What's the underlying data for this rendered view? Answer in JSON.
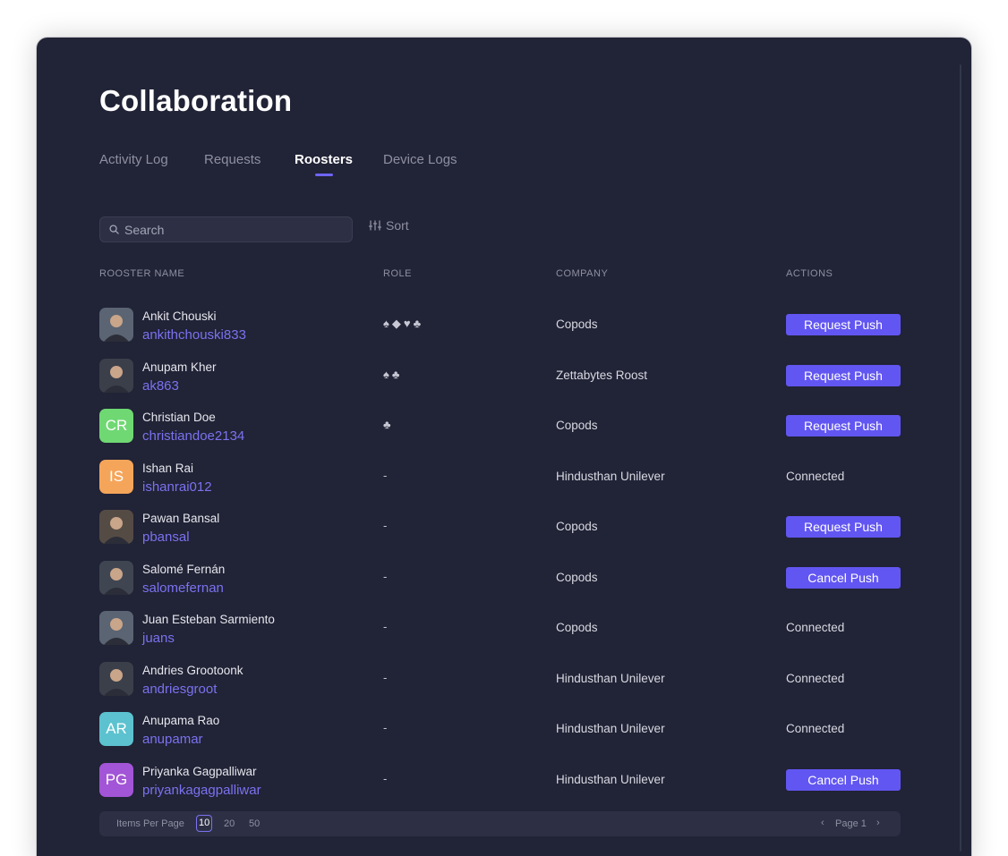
{
  "page": {
    "title": "Collaboration"
  },
  "tabs": [
    {
      "label": "Activity Log",
      "active": false
    },
    {
      "label": "Requests",
      "active": false
    },
    {
      "label": "Roosters",
      "active": true
    },
    {
      "label": "Device Logs",
      "active": false
    }
  ],
  "toolbar": {
    "search_placeholder": "Search",
    "sort_label": "Sort"
  },
  "table": {
    "headers": {
      "name": "ROOSTER NAME",
      "role": "ROLE",
      "company": "COMPANY",
      "actions": "ACTIONS"
    },
    "rows": [
      {
        "name": "Ankit Chouski",
        "username": "ankithchouski833",
        "avatar_type": "photo",
        "role": "♠◆♥♣",
        "company": "Copods",
        "action": "Request Push",
        "action_type": "button"
      },
      {
        "name": "Anupam Kher",
        "username": "ak863",
        "avatar_type": "photo",
        "role": "♠♣",
        "company": "Zettabytes Roost",
        "action": "Request Push",
        "action_type": "button"
      },
      {
        "name": "Christian Doe",
        "username": "christiandoe2134",
        "avatar_type": "initials",
        "initials": "CR",
        "avatar_color": "#6fd873",
        "role": "♣",
        "company": "Copods",
        "action": "Request Push",
        "action_type": "button"
      },
      {
        "name": "Ishan Rai",
        "username": "ishanrai012",
        "avatar_type": "initials",
        "initials": "IS",
        "avatar_color": "#f5a55a",
        "role": "-",
        "company": "Hindusthan Unilever",
        "action": "Connected",
        "action_type": "text"
      },
      {
        "name": "Pawan Bansal",
        "username": "pbansal",
        "avatar_type": "photo",
        "role": "-",
        "company": "Copods",
        "action": "Request Push",
        "action_type": "button"
      },
      {
        "name": "Salomé Fernán",
        "username": "salomefernan",
        "avatar_type": "photo",
        "role": "-",
        "company": "Copods",
        "action": "Cancel Push",
        "action_type": "button"
      },
      {
        "name": "Juan Esteban Sarmiento",
        "username": "juans",
        "avatar_type": "photo",
        "role": "-",
        "company": "Copods",
        "action": "Connected",
        "action_type": "text"
      },
      {
        "name": "Andries Grootoonk",
        "username": "andriesgroot",
        "avatar_type": "photo",
        "role": "-",
        "company": "Hindusthan Unilever",
        "action": "Connected",
        "action_type": "text"
      },
      {
        "name": "Anupama Rao",
        "username": "anupamar",
        "avatar_type": "initials",
        "initials": "AR",
        "avatar_color": "#5cc2cf",
        "role": "-",
        "company": "Hindusthan Unilever",
        "action": "Connected",
        "action_type": "text"
      },
      {
        "name": "Priyanka Gagpalliwar",
        "username": "priyankagagpalliwar",
        "avatar_type": "initials",
        "initials": "PG",
        "avatar_color": "#a255d6",
        "role": "-",
        "company": "Hindusthan Unilever",
        "action": "Cancel Push",
        "action_type": "button"
      }
    ]
  },
  "pagination": {
    "items_per_page_label": "Items Per Page",
    "options": [
      "10",
      "20",
      "50"
    ],
    "selected": "10",
    "page_label": "Page 1"
  },
  "colors": {
    "background": "#212336",
    "accent": "#6256f2",
    "link": "#7b72f0",
    "muted": "#8e90a2"
  }
}
